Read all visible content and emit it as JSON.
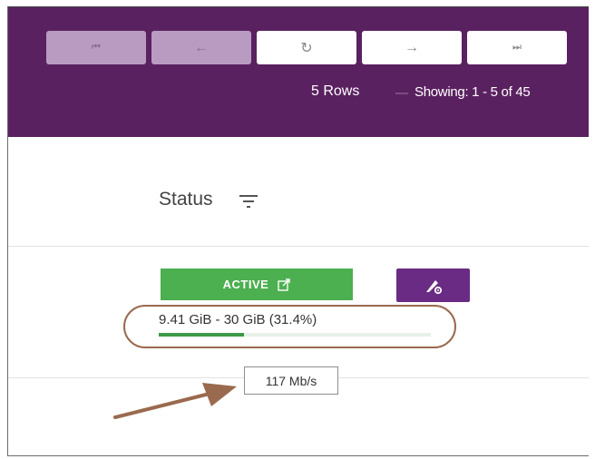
{
  "pagination": {
    "buttons": [
      {
        "icon": "first-page-icon",
        "glyph": "⏮",
        "enabled": false
      },
      {
        "icon": "previous-page-icon",
        "glyph": "←",
        "enabled": false
      },
      {
        "icon": "refresh-icon",
        "glyph": "↻",
        "enabled": true
      },
      {
        "icon": "next-page-icon",
        "glyph": "→",
        "enabled": true
      },
      {
        "icon": "last-page-icon",
        "glyph": "⏭",
        "enabled": true
      }
    ],
    "rows_label": "5 Rows",
    "showing_label": "Showing: 1 - 5 of 45"
  },
  "table": {
    "status_header": "Status"
  },
  "row": {
    "status": "ACTIVE",
    "usage_text": "9.41 GiB - 30 GiB (31.4%)",
    "usage_fraction": 0.314,
    "speed_tooltip": "117 Mb/s"
  },
  "colors": {
    "header_bg": "#5a2160",
    "active_green": "#4caf50",
    "action_purple": "#6a2b84",
    "annotation_brown": "#9a6a4e"
  }
}
